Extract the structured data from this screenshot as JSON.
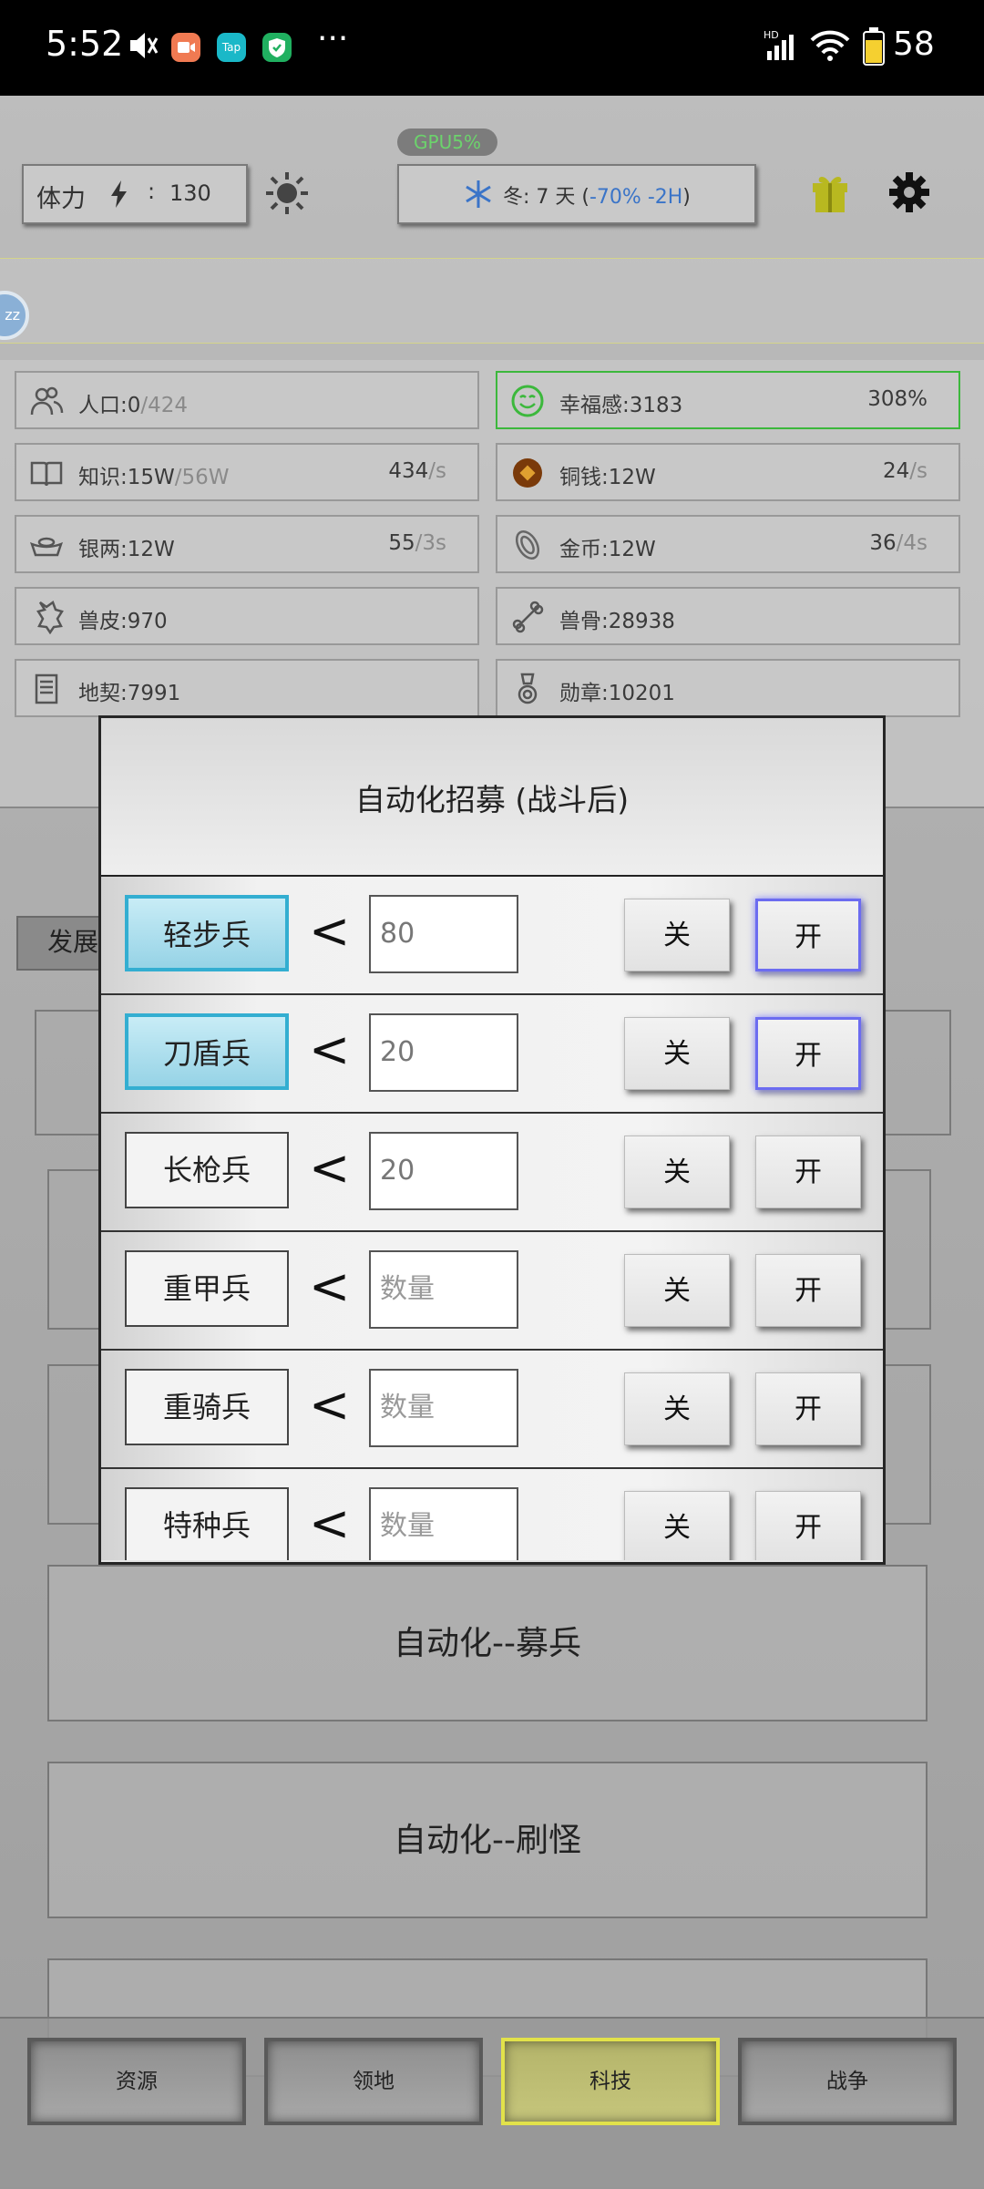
{
  "status_bar": {
    "time": "5:52",
    "battery": "58",
    "more": "···",
    "app_icons": [
      {
        "name": "video-app-icon",
        "color": "#f07a52",
        "label": ""
      },
      {
        "name": "taptap-icon",
        "color": "#1ab8c8",
        "label": "Tap"
      },
      {
        "name": "shield-app-icon",
        "color": "#20b060",
        "label": ""
      }
    ]
  },
  "top_bar": {
    "stamina_label": "体力",
    "stamina_sep": ":",
    "stamina_value": "130",
    "gpu": "GPU5%",
    "season_label": "冬: 7 天 (",
    "season_modifier": "-70% -2H",
    "season_close": ")"
  },
  "side_badge": "zz",
  "resources": [
    {
      "icon": "people-icon",
      "label": "人口:0",
      "max": "/424",
      "rate": "",
      "rate_unit": ""
    },
    {
      "icon": "smile-icon",
      "label": "幸福感:3183",
      "max": "",
      "rate": "308%",
      "rate_unit": ""
    },
    {
      "icon": "book-icon",
      "label": "知识:15W",
      "max": "/56W",
      "rate": "434",
      "rate_unit": "/s"
    },
    {
      "icon": "copper-coin-icon",
      "label": "铜钱:12W",
      "max": "",
      "rate": "24",
      "rate_unit": "/s"
    },
    {
      "icon": "silver-ingot-icon",
      "label": "银两:12W",
      "max": "",
      "rate": "55",
      "rate_unit": "/3s"
    },
    {
      "icon": "gold-coin-icon",
      "label": "金币:12W",
      "max": "",
      "rate": "36",
      "rate_unit": "/4s"
    },
    {
      "icon": "pelt-icon",
      "label": "兽皮:970",
      "max": "",
      "rate": "",
      "rate_unit": ""
    },
    {
      "icon": "bone-icon",
      "label": "兽骨:28938",
      "max": "",
      "rate": "",
      "rate_unit": ""
    },
    {
      "icon": "deed-icon",
      "label": "地契:7991",
      "max": "",
      "rate": "",
      "rate_unit": ""
    },
    {
      "icon": "medal-icon",
      "label": "勋章:10201",
      "max": "",
      "rate": "",
      "rate_unit": ""
    }
  ],
  "behind_tab": "发展",
  "dialog": {
    "title": "自动化招募 (战斗后)",
    "off_label": "关",
    "on_label": "开",
    "lt": "<",
    "rows": [
      {
        "unit": "轻步兵",
        "value": "80",
        "placeholder": "数量"
      },
      {
        "unit": "刀盾兵",
        "value": "20",
        "placeholder": "数量"
      },
      {
        "unit": "长枪兵",
        "value": "20",
        "placeholder": "数量"
      },
      {
        "unit": "重甲兵",
        "value": "",
        "placeholder": "数量"
      },
      {
        "unit": "重骑兵",
        "value": "",
        "placeholder": "数量"
      },
      {
        "unit": "特种兵",
        "value": "",
        "placeholder": "数量"
      }
    ]
  },
  "big_buttons": [
    {
      "label": "自动化--募兵"
    },
    {
      "label": "自动化--刷怪"
    }
  ],
  "bottom_nav": [
    {
      "label": "资源"
    },
    {
      "label": "领地"
    },
    {
      "label": "科技"
    },
    {
      "label": "战争"
    }
  ],
  "colors": {
    "accent_blue": "#33aed1",
    "selected_on": "#6c6cf0",
    "selected_nav": "#e2e24a",
    "happiness_border": "#3cb83c",
    "gpu_green": "#6cd36c",
    "season_blue": "#3a74c8"
  }
}
